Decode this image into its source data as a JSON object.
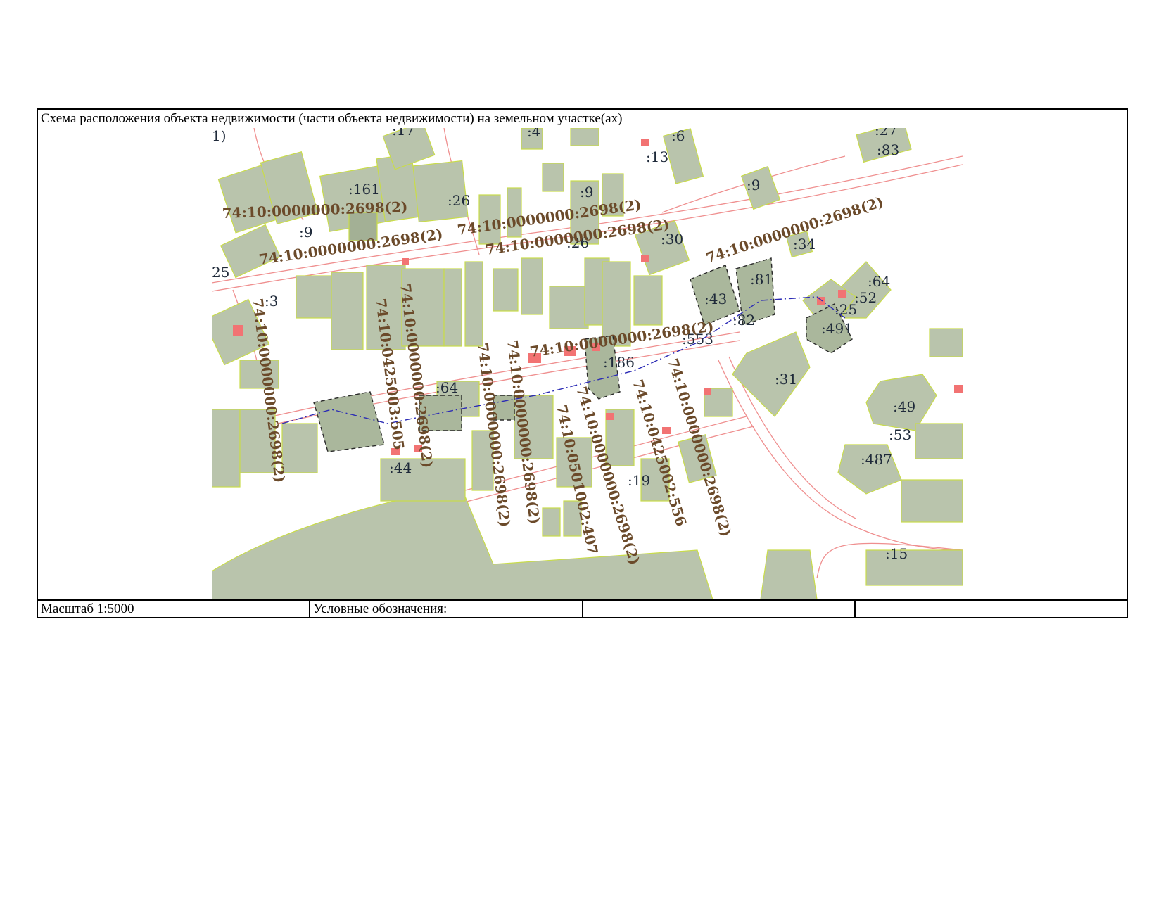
{
  "title": "Схема расположения объекта недвижимости (части объекта недвижимости) на земельном участке(ах)",
  "footer": {
    "scale": "Масштаб 1:5000",
    "legend": "Условные обозначения:",
    "cell3": "",
    "cell4": ""
  },
  "map": {
    "colors": {
      "parcel_fill": "#b9c4ac",
      "parcel_border": "#c9dc4a",
      "building": "#f27373",
      "road_lines": "#ef8f8f",
      "route_line": "#2b2bb5",
      "cadastral_text": "#6b4a2a",
      "parcel_label_text": "#1f2a3a"
    },
    "parcel_labels": {
      "l1": "1)",
      "l4": ":4",
      "l6": ":6",
      "l13": ":13",
      "l27": ":27",
      "l83": ":83",
      "l161": ":161",
      "l26a": ":26",
      "l9a": ":9",
      "l9b": ":9",
      "l9c": ":9",
      "l30": ":30",
      "l34": ":34",
      "l26b": ":26",
      "l25a": "25",
      "l3": ":3",
      "l81": ":81",
      "l43": ":43",
      "l82": ":82",
      "l64a": ":64",
      "l52": ":52",
      "l25b": ":25",
      "l491": ":491",
      "l553": ":553",
      "l186": ":186",
      "l31": ":31",
      "l64b": ":64",
      "l49": ":49",
      "l53": ":53",
      "l487": ":487",
      "l44": ":44",
      "l19": ":19",
      "l15": ":15",
      "l17": ":17"
    },
    "cadastral_labels": {
      "c1": "74:10:0000000:2698(2)",
      "c2": "74:10:0000000:2698(2)",
      "c3": "74:10:0000000:2698(2)",
      "c4": "74:10:0000000:2698(2)",
      "c5": "74:10:0000000:2698(2)",
      "c6": "74:10:0000000:2698(2)",
      "c7": "74:10:0000000:2698(2)",
      "c8": "74:10:0425003:505",
      "c9": "74:10:0000000:2698(2)",
      "c10": "74:10:0000000:2698(2)",
      "c11": "74:10:0000000:2698(2)",
      "c12": "74:10:0501002:407",
      "c13": "74:10:0000000:2698(2)",
      "c14": "74:10:0425002:556",
      "c15": "74:10:0000000:2698(2)"
    }
  }
}
